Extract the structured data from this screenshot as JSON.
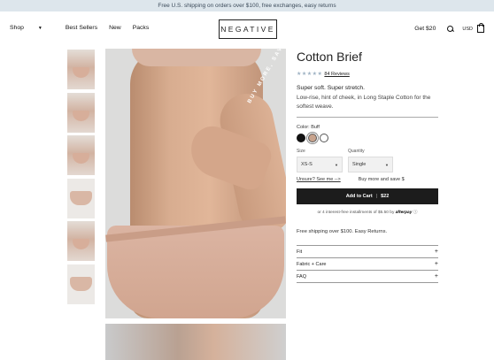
{
  "promo": "Free U.S. shipping on orders over $100, free exchanges, easy returns",
  "nav": {
    "items": [
      {
        "label": "Shop",
        "has_caret": true
      },
      {
        "label": "Best Sellers"
      },
      {
        "label": "New"
      },
      {
        "label": "Packs"
      }
    ],
    "logo": "NEGATIVE",
    "get_link": "Get $20",
    "currency": "USD"
  },
  "gallery": {
    "badge_text": "BUY MORE, SAVE"
  },
  "product": {
    "title": "Cotton Brief",
    "rating": 4.5,
    "stars": "★★★★★",
    "reviews": "84 Reviews",
    "tagline": "Super soft. Super stretch.",
    "description": "Low-rise, hint of cheek, in Long Staple Cotton for the softest weave.",
    "color_label": "Color: Buff",
    "swatches": [
      {
        "name": "Black",
        "hex": "#111111"
      },
      {
        "name": "Buff",
        "hex": "#c8a38d",
        "selected": true
      },
      {
        "name": "White",
        "hex": "#ffffff"
      }
    ],
    "size_label": "Size",
    "size_value": "XS-S",
    "quantity_label": "Quantity",
    "quantity_value": "Single",
    "fit_link": "Unsure? See me -->",
    "buy_more": "Buy more and save $",
    "cart_label": "Add to Cart",
    "price": "$22",
    "afterpay_text": "or 4 interest-free installments of $5.50 by",
    "afterpay_brand": "afterpay",
    "shipping": "Free shipping over $100. Easy Returns.",
    "accordion": [
      {
        "label": "Fit"
      },
      {
        "label": "Fabric + Care"
      },
      {
        "label": "FAQ"
      }
    ]
  },
  "colors": {
    "promo_bg": "#dde6ec",
    "button_bg": "#1c1c1c",
    "star": "#9fb3c4"
  }
}
